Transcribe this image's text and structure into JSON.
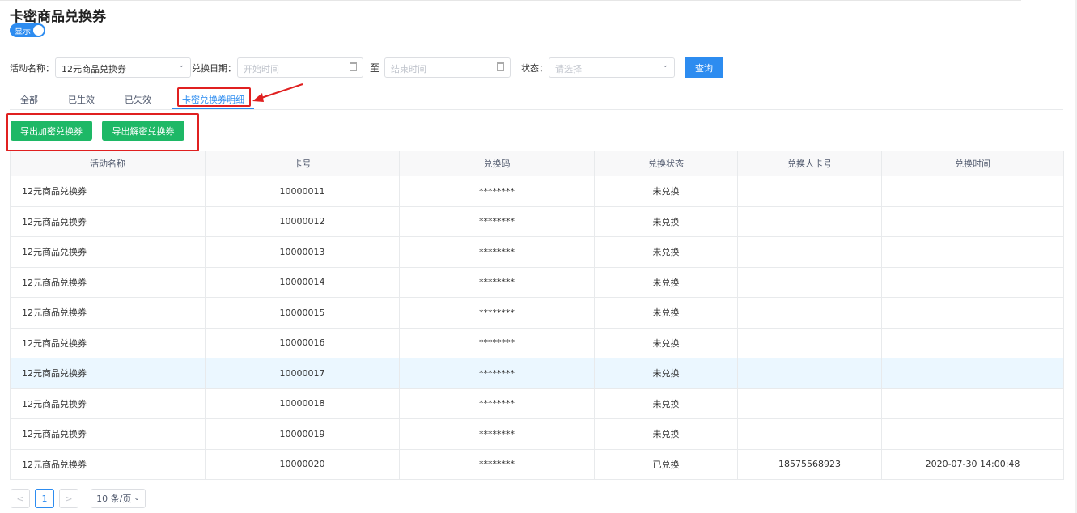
{
  "page": {
    "title": "卡密商品兑换券",
    "toggle_label": "显示"
  },
  "filters": {
    "activity_label": "活动名称：",
    "activity_value": "12元商品兑换券",
    "date_label": "兑换日期：",
    "start_placeholder": "开始时间",
    "to_label": "至",
    "end_placeholder": "结束时间",
    "status_label": "状态：",
    "status_placeholder": "请选择",
    "query_button": "查询"
  },
  "tabs": [
    {
      "label": "全部"
    },
    {
      "label": "已生效"
    },
    {
      "label": "已失效"
    },
    {
      "label": "卡密兑换券明细"
    }
  ],
  "actions": {
    "export_encrypted": "导出加密兑换券",
    "export_decrypted": "导出解密兑换券"
  },
  "table": {
    "columns": [
      "活动名称",
      "卡号",
      "兑换码",
      "兑换状态",
      "兑换人卡号",
      "兑换时间"
    ],
    "rows": [
      [
        "12元商品兑换券",
        "10000011",
        "********",
        "未兑换",
        "",
        ""
      ],
      [
        "12元商品兑换券",
        "10000012",
        "********",
        "未兑换",
        "",
        ""
      ],
      [
        "12元商品兑换券",
        "10000013",
        "********",
        "未兑换",
        "",
        ""
      ],
      [
        "12元商品兑换券",
        "10000014",
        "********",
        "未兑换",
        "",
        ""
      ],
      [
        "12元商品兑换券",
        "10000015",
        "********",
        "未兑换",
        "",
        ""
      ],
      [
        "12元商品兑换券",
        "10000016",
        "********",
        "未兑换",
        "",
        ""
      ],
      [
        "12元商品兑换券",
        "10000017",
        "********",
        "未兑换",
        "",
        ""
      ],
      [
        "12元商品兑换券",
        "10000018",
        "********",
        "未兑换",
        "",
        ""
      ],
      [
        "12元商品兑换券",
        "10000019",
        "********",
        "未兑换",
        "",
        ""
      ],
      [
        "12元商品兑换券",
        "10000020",
        "********",
        "已兑换",
        "18575568923",
        "2020-07-30 14:00:48"
      ]
    ]
  },
  "pagination": {
    "prev": "<",
    "current_page": "1",
    "next": ">",
    "page_size": "10 条/页"
  },
  "colors": {
    "primary": "#2d8cf0",
    "success": "#1eb866",
    "annotation": "#e02020"
  }
}
